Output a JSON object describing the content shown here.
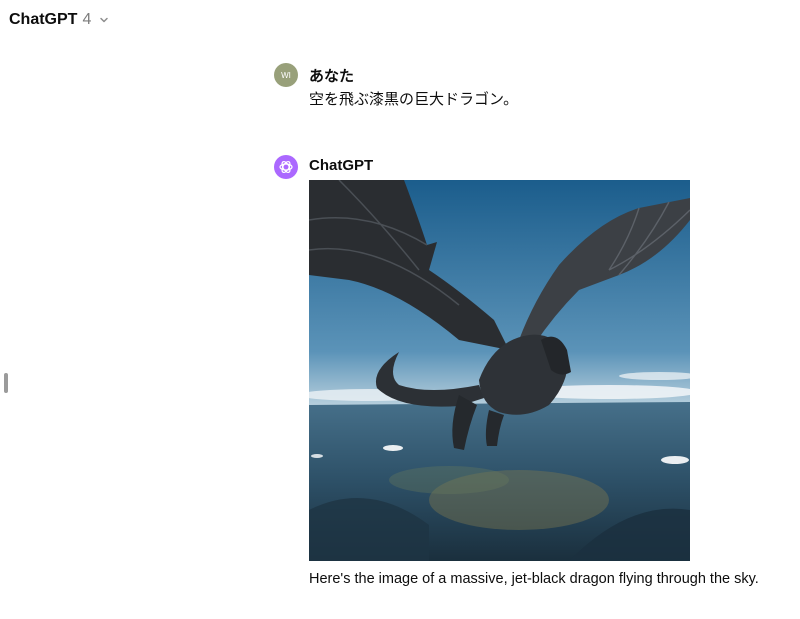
{
  "header": {
    "model_name": "ChatGPT",
    "model_version": "4",
    "dropdown_icon": "chevron-down-icon"
  },
  "conversation": {
    "user_message": {
      "author": "あなた",
      "avatar_initials": "WI",
      "avatar_color": "#98a07a",
      "text": "空を飛ぶ漆黒の巨大ドラゴン。"
    },
    "assistant_message": {
      "author": "ChatGPT",
      "avatar_icon": "openai-logo-icon",
      "avatar_color": "#ab68ff",
      "image_subject": "jet-black dragon flying above clouds and landscape",
      "text": "Here's the image of a massive, jet-black dragon flying through the sky."
    }
  }
}
